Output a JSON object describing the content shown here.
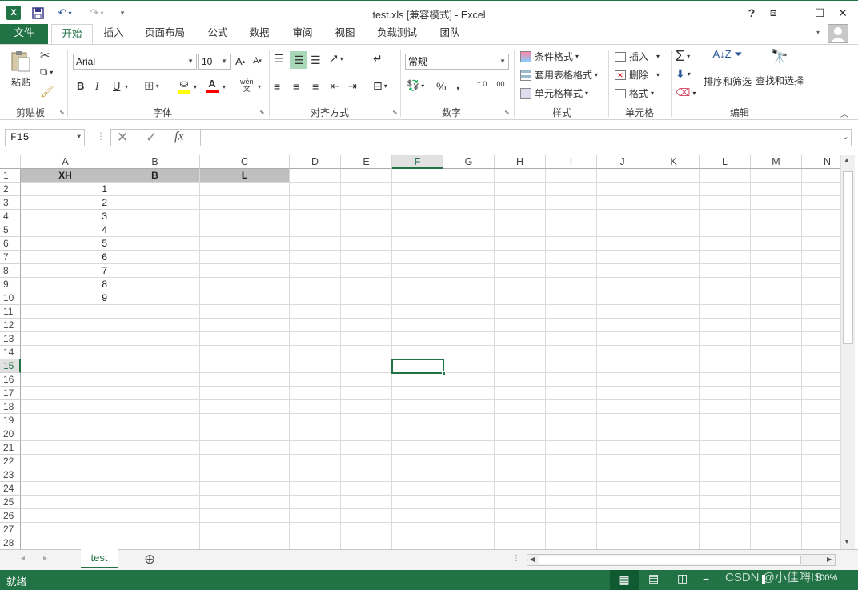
{
  "window": {
    "title": "test.xls  [兼容模式] - Excel",
    "help": "?",
    "restore_ribbon": "⧈",
    "minimize": "—",
    "maximize": "☐",
    "close": "✕"
  },
  "tabs": {
    "file": "文件",
    "home": "开始",
    "insert": "插入",
    "page_layout": "页面布局",
    "formulas": "公式",
    "data": "数据",
    "review": "审阅",
    "view": "视图",
    "load_test": "负载测试",
    "team": "团队"
  },
  "ribbon": {
    "clipboard": {
      "paste": "粘贴",
      "label": "剪贴板"
    },
    "font": {
      "name": "Arial",
      "size": "10",
      "bold": "B",
      "italic": "I",
      "underline": "U",
      "label": "字体"
    },
    "alignment": {
      "label": "对齐方式"
    },
    "number": {
      "format": "常规",
      "percent": "%",
      "comma": ",",
      "label": "数字"
    },
    "styles": {
      "conditional": "条件格式",
      "table": "套用表格格式",
      "cell_styles": "单元格样式",
      "label": "样式"
    },
    "cells": {
      "insert": "插入",
      "delete": "删除",
      "format": "格式",
      "label": "单元格"
    },
    "editing": {
      "sort": "排序和筛选",
      "find": "查找和选择",
      "label": "编辑"
    }
  },
  "formula_bar": {
    "name_box": "F15",
    "cancel": "✕",
    "enter": "✓",
    "fx": "fx",
    "value": ""
  },
  "columns": [
    "A",
    "B",
    "C",
    "D",
    "E",
    "F",
    "G",
    "H",
    "I",
    "J",
    "K",
    "L",
    "M",
    "N"
  ],
  "rows": [
    "1",
    "2",
    "3",
    "4",
    "5",
    "6",
    "7",
    "8",
    "9",
    "10",
    "11",
    "12",
    "13",
    "14",
    "15",
    "16",
    "17",
    "18",
    "19",
    "20",
    "21",
    "22",
    "23",
    "24",
    "25",
    "26",
    "27",
    "28"
  ],
  "cells": {
    "header": [
      "XH",
      "B",
      "L"
    ],
    "a_values": [
      "1",
      "2",
      "3",
      "4",
      "5",
      "6",
      "7",
      "8",
      "9"
    ]
  },
  "selected": {
    "col": "F",
    "row": "15"
  },
  "sheets": {
    "active": "test",
    "add": "⊕"
  },
  "status": {
    "ready": "就绪",
    "zoom": "100%",
    "watermark": "CSDN @小佳嘚IS"
  },
  "colors": {
    "accent": "#217346",
    "header_fill": "#bfbfbf"
  }
}
